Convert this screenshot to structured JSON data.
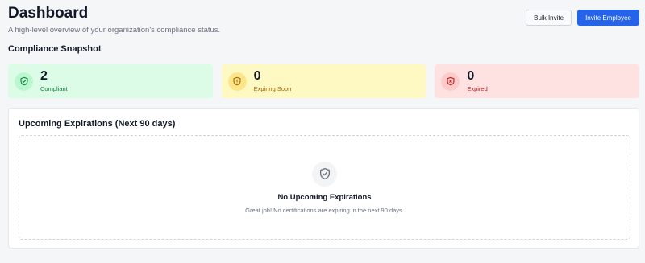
{
  "header": {
    "title": "Dashboard",
    "subtitle": "A high-level overview of your organization's compliance status.",
    "bulk_invite_label": "Bulk Invite",
    "invite_employee_label": "Invite Employee"
  },
  "snapshot": {
    "title": "Compliance Snapshot",
    "cards": [
      {
        "count": "2",
        "label": "Compliant",
        "icon": "shield-check-icon",
        "color": "#15803d"
      },
      {
        "count": "0",
        "label": "Expiring Soon",
        "icon": "shield-alert-icon",
        "color": "#a16207"
      },
      {
        "count": "0",
        "label": "Expired",
        "icon": "shield-x-icon",
        "color": "#b91c1c"
      }
    ]
  },
  "expirations": {
    "title": "Upcoming Expirations (Next 90 days)",
    "empty_icon": "shield-check-icon",
    "empty_title": "No Upcoming Expirations",
    "empty_description": "Great job! No certifications are expiring in the next 90 days."
  },
  "colors": {
    "primary": "#2563eb",
    "compliant_bg": "#dcfce7",
    "expiring_bg": "#fef9c3",
    "expired_bg": "#fee2e2"
  }
}
